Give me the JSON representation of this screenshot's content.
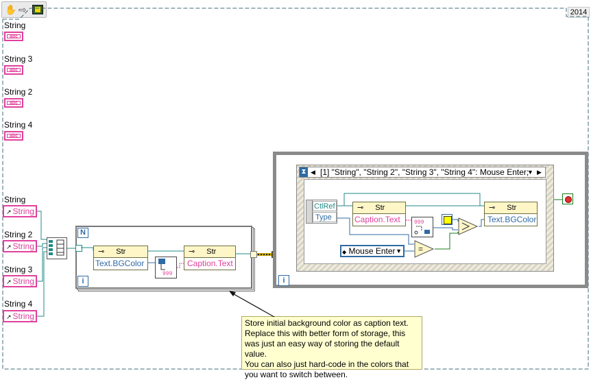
{
  "header": {
    "version": "2014"
  },
  "controls": {
    "terminals": [
      {
        "label": "String"
      },
      {
        "label": "String 3"
      },
      {
        "label": "String 2"
      },
      {
        "label": "String 4"
      }
    ],
    "terminal_glyph": "abc",
    "references": [
      {
        "label": "String",
        "ref_text": "String"
      },
      {
        "label": "String 2",
        "ref_text": "String"
      },
      {
        "label": "String 3",
        "ref_text": "String"
      },
      {
        "label": "String 4",
        "ref_text": "String"
      }
    ]
  },
  "for_loop": {
    "count_label": "N",
    "index_label": "i",
    "node1": {
      "class": "Str",
      "property": "Text.BGColor"
    },
    "node2": {
      "class": "Str",
      "property": "Caption.Text"
    },
    "num_glyph": "999"
  },
  "while_loop": {
    "index_label": "i",
    "event_header": "[1] \"String\", \"String 2\", \"String 3\", \"String 4\": Mouse Enter;",
    "event_data": {
      "field1": "CtlRef",
      "field2": "Type"
    },
    "caption_node": {
      "class": "Str",
      "property": "Caption.Text"
    },
    "bgcolor_node": {
      "class": "Str",
      "property": "Text.BGColor"
    },
    "enum_value": "Mouse Enter",
    "compare_glyph": "=",
    "num_glyph": "999"
  },
  "comment": {
    "text": "Store initial background color as caption text.\nReplace this with better form of storage, this\nwas just an easy way of storing the default value.\nYou can also just hard-code in the colors that\nyou want to switch between."
  },
  "colors": {
    "string_wire": "#e0409c",
    "ref_wire": "#1f8a86",
    "numeric_wire": "#2f6aa3",
    "bool_wire": "#1a7a1a",
    "property_node_fill": "#fff6c8",
    "loop_frame": "#8a8a8a"
  }
}
